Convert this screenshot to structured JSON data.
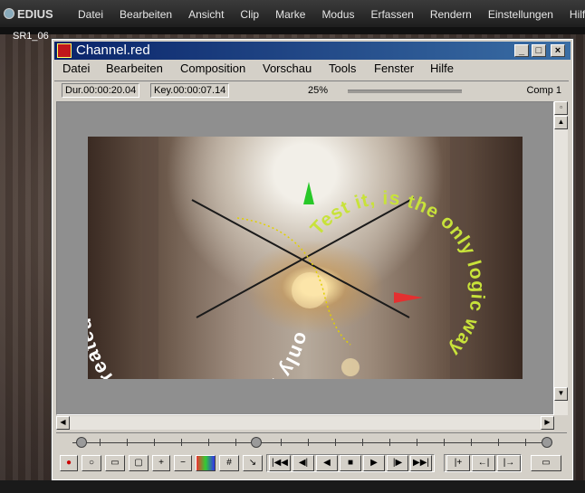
{
  "host_app": {
    "name": "EDIUS",
    "menu": [
      "Datei",
      "Bearbeiten",
      "Ansicht",
      "Clip",
      "Marke",
      "Modus",
      "Erfassen",
      "Rendern",
      "Einstellungen",
      "Hilfe"
    ],
    "clip_label": "SR1_06"
  },
  "window": {
    "title": "Channel.red",
    "controls": {
      "minimize": "_",
      "maximize": "□",
      "close": "×"
    },
    "menu": [
      "Datei",
      "Bearbeiten",
      "Composition",
      "Vorschau",
      "Tools",
      "Fenster",
      "Hilfe"
    ],
    "info": {
      "duration": "Dur.00:00:20.04",
      "key": "Key.00:00:07.14",
      "zoom": "25%",
      "comp": "Comp 1"
    }
  },
  "overlay_text": {
    "left_arc": "only for „Bassmann“ created",
    "right_arc": "Test it, is the only logic way",
    "left_color": "#ffffff",
    "right_color": "#c8e23a"
  },
  "icons": {
    "transport": [
      "skip-start-icon",
      "step-back-icon",
      "play-reverse-icon",
      "stop-icon",
      "play-icon",
      "step-forward-icon",
      "skip-end-icon"
    ],
    "tools": [
      "record-icon",
      "circle-tool-icon",
      "rect-tool-icon",
      "rounded-rect-icon",
      "zoom-in-icon",
      "zoom-out-icon",
      "color-icon",
      "grid-icon",
      "path-icon"
    ]
  },
  "colors": {
    "title_start": "#0a246a",
    "title_end": "#3a6ea5",
    "window_face": "#d4d0c8"
  }
}
